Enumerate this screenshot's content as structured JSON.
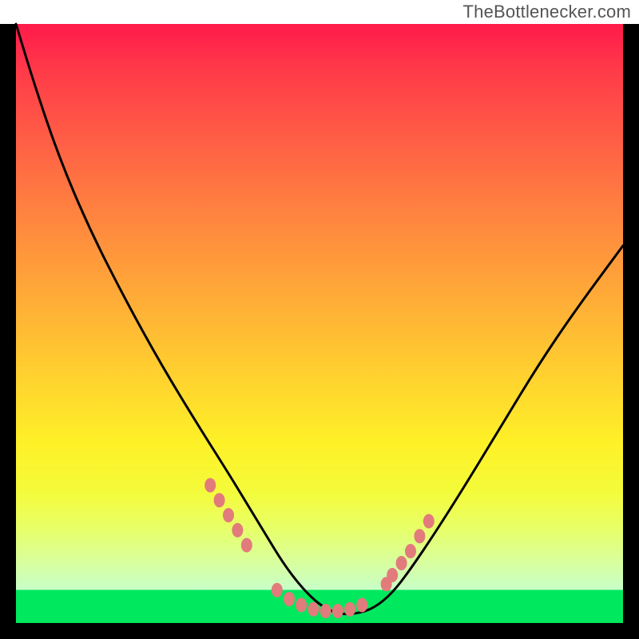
{
  "watermark": "TheBottlenecker.com",
  "gradient_colors": {
    "top": "#ff1a4a",
    "mid1": "#ff8a3e",
    "mid2": "#ffd52e",
    "mid3": "#e8ff66",
    "bottom_band": "#00e85e"
  },
  "curve_color": "#000000",
  "marker_color": "#e27b7b",
  "chart_data": {
    "type": "line",
    "title": "",
    "xlabel": "",
    "ylabel": "",
    "xlim": [
      0,
      100
    ],
    "ylim": [
      0,
      100
    ],
    "note": "Axes are unlabeled in the source image; x/y are normalized 0-100. The curve is a V-shaped bottleneck profile with markers near the minimum.",
    "series": [
      {
        "name": "bottleneck-curve",
        "x": [
          0,
          3,
          7,
          12,
          18,
          24,
          30,
          35,
          38,
          41,
          44,
          47,
          50,
          53,
          56,
          59,
          62,
          65,
          69,
          74,
          80,
          86,
          92,
          100
        ],
        "y": [
          100,
          90,
          78,
          66,
          54,
          43,
          33,
          25,
          20,
          15,
          10,
          6,
          3,
          1.5,
          1.5,
          2.5,
          5,
          9,
          15,
          23,
          33,
          43,
          52,
          63
        ]
      }
    ],
    "markers": {
      "name": "highlight-dots",
      "x": [
        32,
        33.5,
        35,
        36.5,
        38,
        43,
        45,
        47,
        49,
        51,
        53,
        55,
        57,
        61,
        62,
        63.5,
        65,
        66.5,
        68
      ],
      "y": [
        23,
        20.5,
        18,
        15.5,
        13,
        5.5,
        4,
        3,
        2.3,
        2,
        2,
        2.3,
        3,
        6.5,
        8,
        10,
        12,
        14.5,
        17
      ]
    }
  }
}
